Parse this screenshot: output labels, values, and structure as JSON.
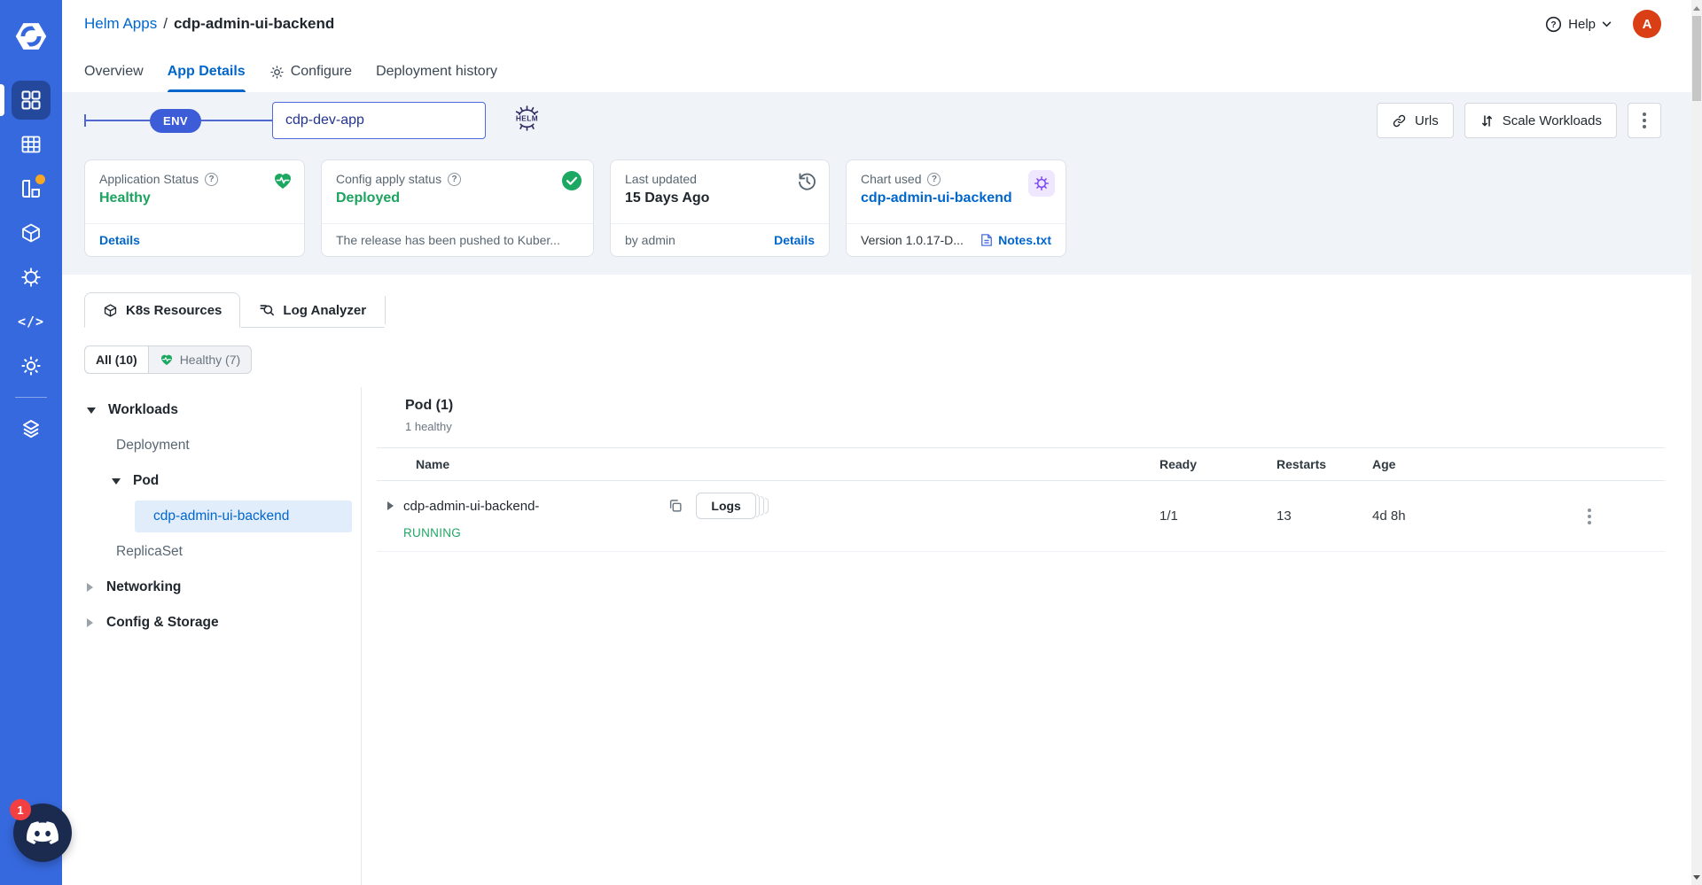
{
  "topbar": {
    "breadcrumb": {
      "parent": "Helm Apps",
      "separator": "/",
      "current": "cdp-admin-ui-backend"
    },
    "tabs": [
      {
        "label": "Overview",
        "active": false
      },
      {
        "label": "App Details",
        "active": true
      },
      {
        "label": "Configure",
        "active": false,
        "icon": "gear-icon"
      },
      {
        "label": "Deployment history",
        "active": false
      }
    ],
    "help_label": "Help",
    "avatar_initial": "A"
  },
  "env_bar": {
    "badge": "ENV",
    "app_name": "cdp-dev-app",
    "icon": "helm-logo"
  },
  "actions": {
    "urls_label": "Urls",
    "scale_label": "Scale Workloads",
    "more_icon": "kebab-menu-icon"
  },
  "status_cards": [
    {
      "title": "Application Status",
      "value": "Healthy",
      "icon": "heart-pulse-icon",
      "footer_link": "Details"
    },
    {
      "title": "Config apply status",
      "value": "Deployed",
      "icon": "check-circle-icon",
      "footer_text": "The release has been pushed to Kuber..."
    },
    {
      "title": "Last updated",
      "value": "15 Days Ago",
      "icon": "history-icon",
      "footer_text": "by admin",
      "footer_link": "Details"
    },
    {
      "title": "Chart used",
      "value": "cdp-admin-ui-backend",
      "icon": "helm-wheel-icon",
      "footer_text": "Version 1.0.17-D...",
      "footer_link": "Notes.txt",
      "footer_link_icon": "document-icon"
    }
  ],
  "resource_tabs": [
    {
      "label": "K8s Resources",
      "active": true,
      "icon": "cube-icon"
    },
    {
      "label": "Log Analyzer",
      "active": false,
      "icon": "log-search-icon"
    }
  ],
  "filters": [
    {
      "label": "All (10)",
      "active": true
    },
    {
      "label": "Healthy (7)",
      "active": false,
      "icon": "heart-pulse-icon"
    }
  ],
  "tree": {
    "workloads": "Workloads",
    "deployment": "Deployment",
    "pod": "Pod",
    "pod_name": "cdp-admin-ui-backend",
    "replicaset": "ReplicaSet",
    "networking": "Networking",
    "config_storage": "Config & Storage"
  },
  "pod_table": {
    "title": "Pod (1)",
    "subtitle": "1 healthy",
    "columns": [
      "Name",
      "Ready",
      "Restarts",
      "Age"
    ],
    "rows": [
      {
        "name": "cdp-admin-ui-backend-",
        "status": "RUNNING",
        "logs_label": "Logs",
        "ready": "1/1",
        "restarts": "13",
        "age": "4d 8h"
      }
    ]
  },
  "floating": {
    "discord_badge": "1"
  },
  "colors": {
    "sidebar_blue": "#3669de",
    "sidebar_active": "#24489b",
    "link_blue": "#0066cc",
    "status_green": "#1ca35f",
    "band_grey": "#f0f3f7",
    "chart_purple": "#7d4bf0",
    "avatar_orange": "#da3e14",
    "badge_red": "#f23f42",
    "env_indigo": "#3d5cd7",
    "helm_navy": "#312b65",
    "accent_orange_dot": "#f6a723"
  }
}
